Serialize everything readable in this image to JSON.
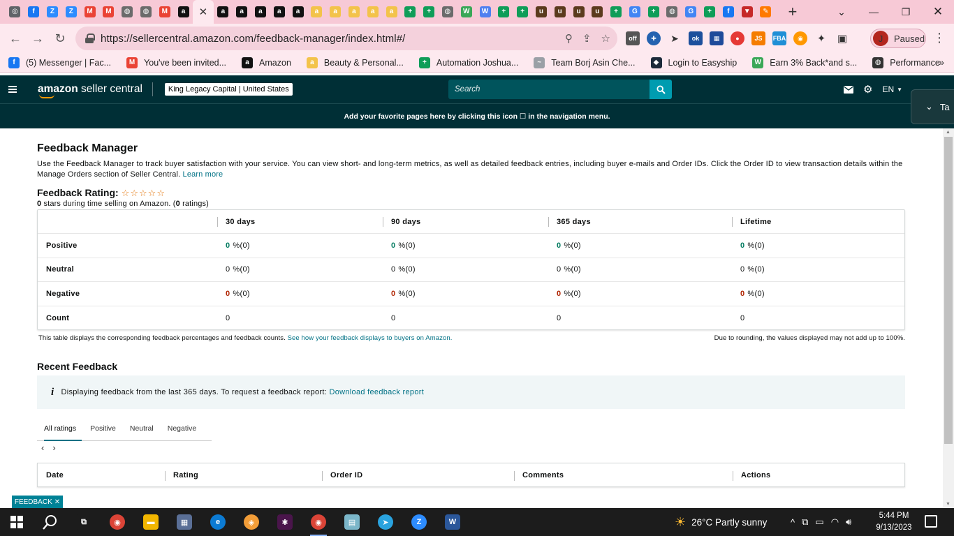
{
  "browser": {
    "tab_favicons": [
      {
        "icon": "chrome-icon",
        "color": "#5f6368",
        "glyph": "◎"
      },
      {
        "icon": "facebook-icon",
        "color": "#1877f2",
        "glyph": "f"
      },
      {
        "icon": "zoom-icon",
        "color": "#2d8cff",
        "glyph": "Z"
      },
      {
        "icon": "zoom-icon",
        "color": "#2d8cff",
        "glyph": "Z"
      },
      {
        "icon": "gmail-icon",
        "color": "#ea4335",
        "glyph": "M"
      },
      {
        "icon": "gmail-icon",
        "color": "#ea4335",
        "glyph": "M"
      },
      {
        "icon": "globe-icon",
        "color": "#6b6b6b",
        "glyph": "◍"
      },
      {
        "icon": "globe-icon",
        "color": "#6b6b6b",
        "glyph": "◍"
      },
      {
        "icon": "gmail-icon",
        "color": "#ea4335",
        "glyph": "M"
      },
      {
        "icon": "amazon-icon",
        "color": "#111111",
        "glyph": "a"
      },
      {
        "icon": "close-tab-icon",
        "color": "#333333",
        "glyph": "✕",
        "active": true
      },
      {
        "icon": "amazon-icon",
        "color": "#111111",
        "glyph": "a"
      },
      {
        "icon": "amazon-icon",
        "color": "#111111",
        "glyph": "a"
      },
      {
        "icon": "amazon-icon",
        "color": "#111111",
        "glyph": "a"
      },
      {
        "icon": "amazon-icon",
        "color": "#111111",
        "glyph": "a"
      },
      {
        "icon": "amazon-icon",
        "color": "#111111",
        "glyph": "a"
      },
      {
        "icon": "amazon-smile-icon",
        "color": "#f3c34a",
        "glyph": "a"
      },
      {
        "icon": "amazon-smile-icon",
        "color": "#f3c34a",
        "glyph": "a"
      },
      {
        "icon": "amazon-smile-icon",
        "color": "#f3c34a",
        "glyph": "a"
      },
      {
        "icon": "amazon-smile-icon",
        "color": "#f3c34a",
        "glyph": "a"
      },
      {
        "icon": "amazon-smile-icon",
        "color": "#f3c34a",
        "glyph": "a"
      },
      {
        "icon": "sheets-plus-icon",
        "color": "#0f9d58",
        "glyph": "+"
      },
      {
        "icon": "sheets-plus-icon",
        "color": "#0f9d58",
        "glyph": "+"
      },
      {
        "icon": "globe-icon",
        "color": "#6b6b6b",
        "glyph": "◍"
      },
      {
        "icon": "w-green-icon",
        "color": "#3aa757",
        "glyph": "W"
      },
      {
        "icon": "w-blue-icon",
        "color": "#4f7ff0",
        "glyph": "W"
      },
      {
        "icon": "sheets-plus-icon",
        "color": "#0f9d58",
        "glyph": "+"
      },
      {
        "icon": "sheets-plus-icon",
        "color": "#0f9d58",
        "glyph": "+"
      },
      {
        "icon": "ups-icon",
        "color": "#5b3a1d",
        "glyph": "u"
      },
      {
        "icon": "ups-icon",
        "color": "#5b3a1d",
        "glyph": "u"
      },
      {
        "icon": "ups-icon",
        "color": "#5b3a1d",
        "glyph": "u"
      },
      {
        "icon": "ups-icon",
        "color": "#5b3a1d",
        "glyph": "u"
      },
      {
        "icon": "sheets-plus-icon",
        "color": "#0f9d58",
        "glyph": "+"
      },
      {
        "icon": "google-icon",
        "color": "#4285f4",
        "glyph": "G"
      },
      {
        "icon": "sheets-plus-icon",
        "color": "#0f9d58",
        "glyph": "+"
      },
      {
        "icon": "globe-icon",
        "color": "#6b6b6b",
        "glyph": "◍"
      },
      {
        "icon": "google-icon",
        "color": "#4285f4",
        "glyph": "G"
      },
      {
        "icon": "sheets-plus-icon",
        "color": "#0f9d58",
        "glyph": "+"
      },
      {
        "icon": "facebook-icon",
        "color": "#1877f2",
        "glyph": "f"
      },
      {
        "icon": "shield-red-icon",
        "color": "#c62828",
        "glyph": "▼"
      },
      {
        "icon": "pen-icon",
        "color": "#ff7a00",
        "glyph": "✎"
      }
    ],
    "new_tab_glyph": "+",
    "url": "https://sellercentral.amazon.com/feedback-manager/index.html#/",
    "profile_initial": "J",
    "profile_status": "Paused",
    "bookmarks": [
      {
        "label": "(5) Messenger | Fac...",
        "icon": "facebook-icon",
        "color": "#1877f2",
        "glyph": "f"
      },
      {
        "label": "You've been invited...",
        "icon": "gmail-icon",
        "color": "#ea4335",
        "glyph": "M"
      },
      {
        "label": "Amazon",
        "icon": "amazon-icon",
        "color": "#111111",
        "glyph": "a"
      },
      {
        "label": "Beauty & Personal...",
        "icon": "amazon-smile-icon",
        "color": "#f3c34a",
        "glyph": "a"
      },
      {
        "label": "Automation Joshua...",
        "icon": "sheets-plus-icon",
        "color": "#0f9d58",
        "glyph": "+"
      },
      {
        "label": "Team Borj Asin Che...",
        "icon": "signature-icon",
        "color": "#9aa0a6",
        "glyph": "~"
      },
      {
        "label": "Login to Easyship",
        "icon": "easyship-icon",
        "color": "#1c2a3a",
        "glyph": "◆"
      },
      {
        "label": "Earn 3% Back*and s...",
        "icon": "w-green-icon",
        "color": "#3aa757",
        "glyph": "W"
      },
      {
        "label": "Performance",
        "icon": "globe-icon",
        "color": "#333333",
        "glyph": "◍"
      }
    ]
  },
  "header": {
    "logo_brand": "amazon",
    "logo_product": "seller central",
    "marketplace": "King Legacy Capital | United States",
    "search_placeholder": "Search",
    "language": "EN",
    "favorites_banner": "Add your favorite pages here by clicking this icon ☐ in the navigation menu.",
    "popup_label": "Ta"
  },
  "page": {
    "title": "Feedback Manager",
    "intro": "Use the Feedback Manager to track buyer satisfaction with your service. You can view short- and long-term metrics, as well as detailed feedback entries, including buyer e-mails and Order IDs. Click the Order ID to view transaction details within the Manage Orders section of Seller Central.",
    "learn_more": "Learn more",
    "rating_label": "Feedback Rating:",
    "rating_stars_filled": 0,
    "rating_stars_total": 5,
    "rating_summary_stars": "0",
    "rating_summary_mid": " stars during time selling on Amazon. (",
    "rating_summary_count": "0",
    "rating_summary_end": " ratings)",
    "table": {
      "columns": [
        "",
        "30 days",
        "90 days",
        "365 days",
        "Lifetime"
      ],
      "rows": [
        {
          "label": "Positive",
          "kind": "pos",
          "cells": [
            {
              "pct": "0",
              "rest": "%(0)"
            },
            {
              "pct": "0",
              "rest": "%(0)"
            },
            {
              "pct": "0",
              "rest": "%(0)"
            },
            {
              "pct": "0",
              "rest": "%(0)"
            }
          ]
        },
        {
          "label": "Neutral",
          "kind": "neu",
          "cells": [
            {
              "pct": "0",
              "rest": "%(0)"
            },
            {
              "pct": "0",
              "rest": "%(0)"
            },
            {
              "pct": "0",
              "rest": "%(0)"
            },
            {
              "pct": "0",
              "rest": "%(0)"
            }
          ]
        },
        {
          "label": "Negative",
          "kind": "neg",
          "cells": [
            {
              "pct": "0",
              "rest": "%(0)"
            },
            {
              "pct": "0",
              "rest": "%(0)"
            },
            {
              "pct": "0",
              "rest": "%(0)"
            },
            {
              "pct": "0",
              "rest": "%(0)"
            }
          ]
        },
        {
          "label": "Count",
          "kind": "count",
          "cells": [
            {
              "pct": "",
              "rest": "0"
            },
            {
              "pct": "",
              "rest": "0"
            },
            {
              "pct": "",
              "rest": "0"
            },
            {
              "pct": "",
              "rest": "0"
            }
          ]
        }
      ]
    },
    "table_note": "This table displays the corresponding feedback percentages and feedback counts.",
    "table_note_link": "See how your feedback displays to buyers on Amazon.",
    "rounding_note": "Due to rounding, the values displayed may not add up to 100%.",
    "recent_title": "Recent Feedback",
    "alert_text": "Displaying feedback from the last 365 days. To request a feedback report:",
    "alert_link": "Download feedback report",
    "rating_tabs": [
      "All ratings",
      "Positive",
      "Neutral",
      "Negative"
    ],
    "active_tab": 0,
    "recent_columns": [
      "Date",
      "Rating",
      "Order ID",
      "Comments",
      "Actions"
    ],
    "feedback_tag": "FEEDBACK"
  },
  "taskbar": {
    "apps": [
      {
        "icon": "task-view-icon",
        "color": "#1c1c1c",
        "glyph": "⧉"
      },
      {
        "icon": "chrome-icon",
        "color": "#db4437",
        "glyph": "◉"
      },
      {
        "icon": "file-explorer-icon",
        "color": "#f2b600",
        "glyph": "▬"
      },
      {
        "icon": "network-app-icon",
        "color": "#5a6f96",
        "glyph": "▦"
      },
      {
        "icon": "edge-icon",
        "color": "#0c7bd3",
        "glyph": "e"
      },
      {
        "icon": "vpn-shield-icon",
        "color": "#f29d38",
        "glyph": "◈"
      },
      {
        "icon": "slack-icon",
        "color": "#4a154b",
        "glyph": "✱"
      },
      {
        "icon": "chrome-profile-icon",
        "color": "#db4437",
        "glyph": "◉",
        "active": true
      },
      {
        "icon": "notes-icon",
        "color": "#7bb6c9",
        "glyph": "▤"
      },
      {
        "icon": "telegram-icon",
        "color": "#2aa3df",
        "glyph": "➤"
      },
      {
        "icon": "zoom-icon",
        "color": "#2d8cff",
        "glyph": "Z"
      },
      {
        "icon": "word-icon",
        "color": "#2b579a",
        "glyph": "W"
      }
    ],
    "weather": "26°C  Partly sunny",
    "time": "5:44 PM",
    "date": "9/13/2023"
  }
}
